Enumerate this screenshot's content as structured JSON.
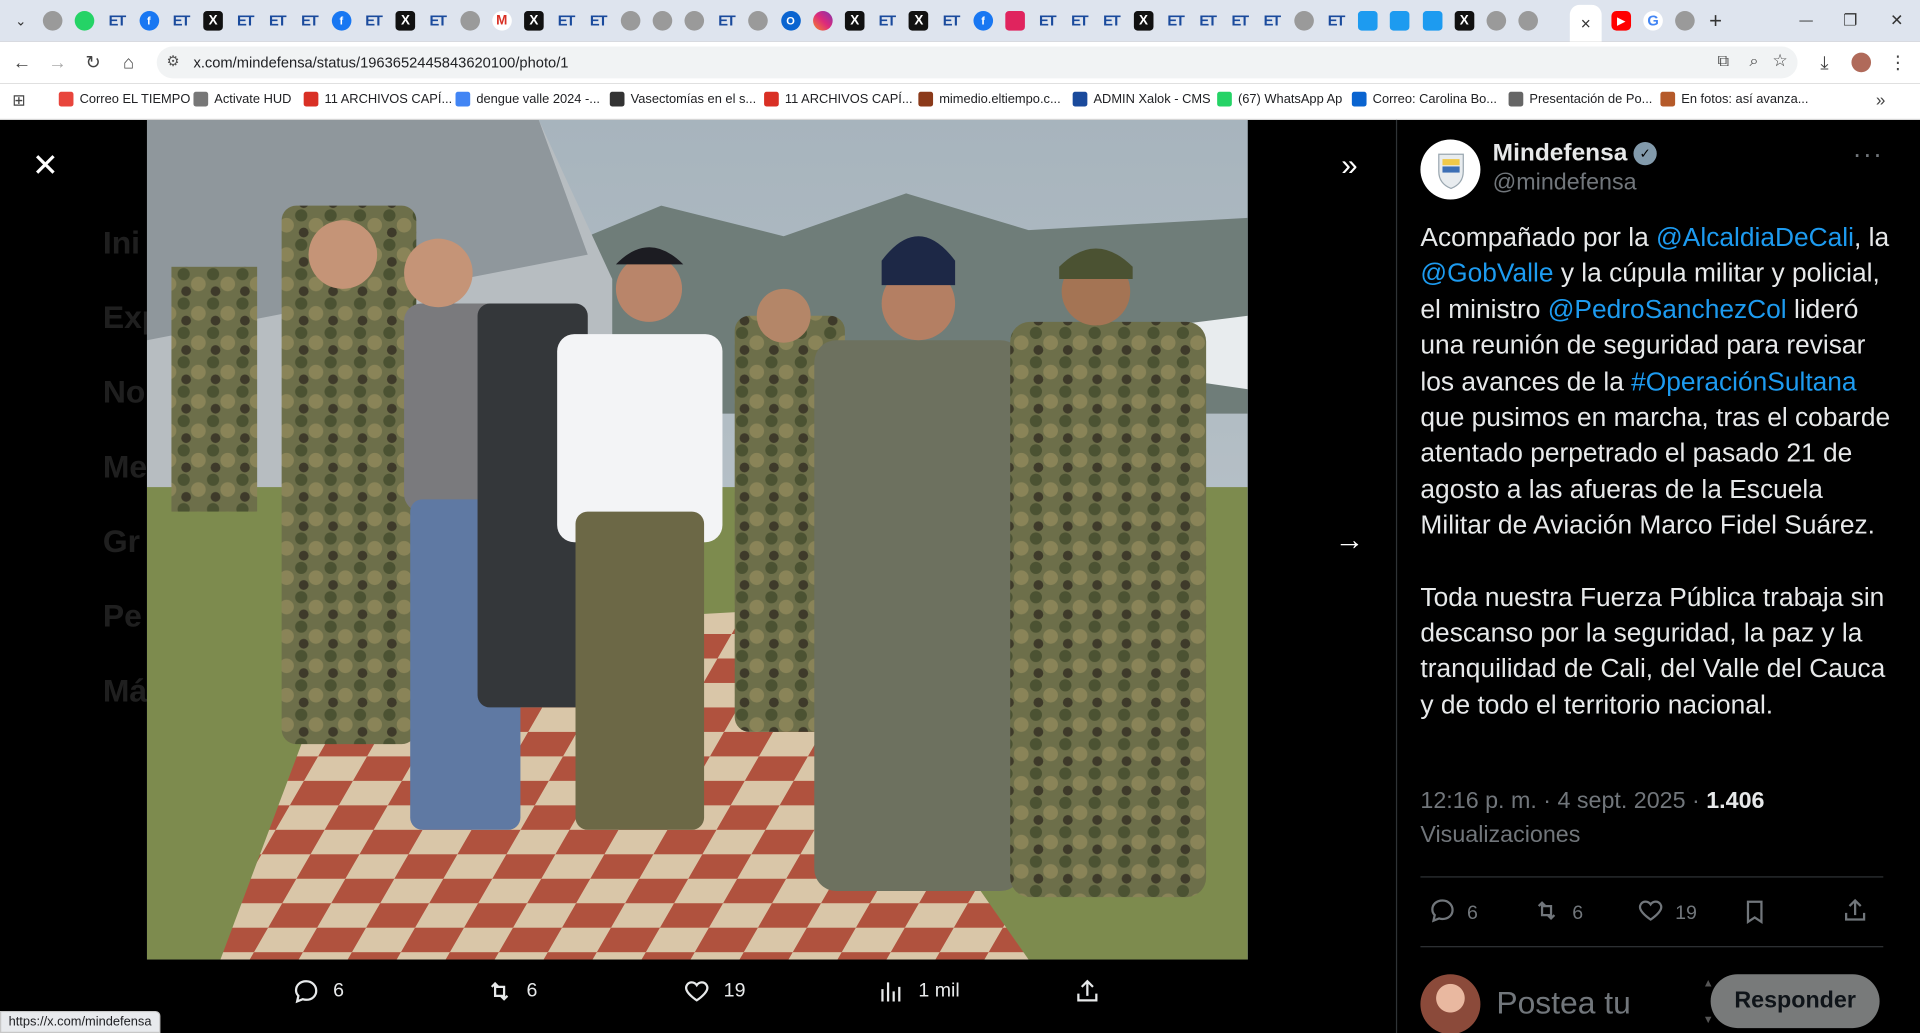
{
  "browser": {
    "tabs": [
      {
        "icon": "gray-globe-icon",
        "kind": "gr",
        "glyph": ""
      },
      {
        "icon": "whatsapp-icon",
        "kind": "wa",
        "glyph": ""
      },
      {
        "icon": "et-icon",
        "kind": "et",
        "glyph": "ET"
      },
      {
        "icon": "facebook-icon",
        "kind": "fb",
        "glyph": "f"
      },
      {
        "icon": "et-icon",
        "kind": "et",
        "glyph": "ET"
      },
      {
        "icon": "x-icon",
        "kind": "x",
        "glyph": "X"
      },
      {
        "icon": "et-icon",
        "kind": "et",
        "glyph": "ET"
      },
      {
        "icon": "et-icon",
        "kind": "et",
        "glyph": "ET"
      },
      {
        "icon": "et-icon",
        "kind": "et",
        "glyph": "ET"
      },
      {
        "icon": "facebook-icon",
        "kind": "fb",
        "glyph": "f"
      },
      {
        "icon": "et-icon",
        "kind": "et",
        "glyph": "ET"
      },
      {
        "icon": "x-icon",
        "kind": "x",
        "glyph": "X"
      },
      {
        "icon": "et-icon",
        "kind": "et",
        "glyph": "ET"
      },
      {
        "icon": "gray-globe-icon",
        "kind": "gr",
        "glyph": ""
      },
      {
        "icon": "gmail-icon",
        "kind": "gm",
        "glyph": "M"
      },
      {
        "icon": "x-icon",
        "kind": "x",
        "glyph": "X"
      },
      {
        "icon": "et-icon",
        "kind": "et",
        "glyph": "ET"
      },
      {
        "icon": "et-icon",
        "kind": "et",
        "glyph": "ET"
      },
      {
        "icon": "gray-globe-icon",
        "kind": "gr",
        "glyph": ""
      },
      {
        "icon": "gray-globe-icon",
        "kind": "gr",
        "glyph": ""
      },
      {
        "icon": "gray-globe-icon",
        "kind": "gr",
        "glyph": ""
      },
      {
        "icon": "et-icon",
        "kind": "et",
        "glyph": "ET"
      },
      {
        "icon": "gray-globe-icon",
        "kind": "gr",
        "glyph": ""
      },
      {
        "icon": "outlook-icon",
        "kind": "ol",
        "glyph": "O"
      },
      {
        "icon": "instagram-icon",
        "kind": "ig",
        "glyph": ""
      },
      {
        "icon": "x-icon",
        "kind": "x",
        "glyph": "X"
      },
      {
        "icon": "et-icon",
        "kind": "et",
        "glyph": "ET"
      },
      {
        "icon": "x-icon",
        "kind": "x",
        "glyph": "X"
      },
      {
        "icon": "et-icon",
        "kind": "et",
        "glyph": "ET"
      },
      {
        "icon": "facebook-icon",
        "kind": "fb",
        "glyph": "f"
      },
      {
        "icon": "red-app-icon",
        "kind": "rd",
        "glyph": ""
      },
      {
        "icon": "et-icon",
        "kind": "et",
        "glyph": "ET"
      },
      {
        "icon": "et-icon",
        "kind": "et",
        "glyph": "ET"
      },
      {
        "icon": "et-icon",
        "kind": "et",
        "glyph": "ET"
      },
      {
        "icon": "x-icon",
        "kind": "x",
        "glyph": "X"
      },
      {
        "icon": "et-icon",
        "kind": "et",
        "glyph": "ET"
      },
      {
        "icon": "et-icon",
        "kind": "et",
        "glyph": "ET"
      },
      {
        "icon": "et-icon",
        "kind": "et",
        "glyph": "ET"
      },
      {
        "icon": "et-icon",
        "kind": "et",
        "glyph": "ET"
      },
      {
        "icon": "gray-globe-icon",
        "kind": "gr",
        "glyph": ""
      },
      {
        "icon": "et-icon",
        "kind": "et",
        "glyph": "ET"
      },
      {
        "icon": "blue-edit-icon",
        "kind": "bl",
        "glyph": ""
      },
      {
        "icon": "blue-edit-icon",
        "kind": "bl",
        "glyph": ""
      },
      {
        "icon": "blue-app-icon",
        "kind": "bl",
        "glyph": ""
      },
      {
        "icon": "x-icon",
        "kind": "x",
        "glyph": "X"
      },
      {
        "icon": "gray-globe-icon",
        "kind": "gr",
        "glyph": ""
      },
      {
        "icon": "gray-globe-icon",
        "kind": "gr",
        "glyph": ""
      }
    ],
    "active_tab_close": "×",
    "trailing_tabs": [
      {
        "icon": "youtube-icon",
        "kind": "yt",
        "glyph": "▶"
      },
      {
        "icon": "google-icon",
        "kind": "gg",
        "glyph": "G"
      },
      {
        "icon": "gray-globe-icon",
        "kind": "gr",
        "glyph": ""
      }
    ],
    "new_tab": "+",
    "window_controls": {
      "minimize": "—",
      "restore": "❐",
      "close": "✕"
    },
    "url": "x.com/mindefensa/status/1963652445843620100/photo/1",
    "bookmarks": [
      {
        "label": "Correo EL TIEMPO",
        "color": "#e8453c"
      },
      {
        "label": "Activate HUD",
        "color": "#777777"
      },
      {
        "label": "11 ARCHIVOS CAPÍ...",
        "color": "#d93025"
      },
      {
        "label": "dengue valle 2024 -...",
        "color": "#4285f4"
      },
      {
        "label": "Vasectomías en el s...",
        "color": "#333333"
      },
      {
        "label": "11 ARCHIVOS CAPÍ...",
        "color": "#d93025"
      },
      {
        "label": "mimedio.eltiempo.c...",
        "color": "#8b3a1a"
      },
      {
        "label": "ADMIN Xalok - CMS",
        "color": "#1a4a9c"
      },
      {
        "label": "(67) WhatsApp Ap",
        "color": "#25d366"
      },
      {
        "label": "Correo: Carolina Bo...",
        "color": "#0a64d0"
      },
      {
        "label": "Presentación de Po...",
        "color": "#666666"
      },
      {
        "label": "En fotos: así avanza...",
        "color": "#b55a2a"
      }
    ],
    "status_url": "https://x.com/mindefensa"
  },
  "background_nav": [
    "Ini",
    "Exp",
    "No",
    "Me",
    "Gr",
    "Pe",
    "Má"
  ],
  "viewer": {
    "close_icon": "✕",
    "collapse_icon": "»",
    "next_icon": "→",
    "actions": {
      "replies": "6",
      "reposts": "6",
      "likes": "19",
      "views": "1 mil"
    }
  },
  "tweet": {
    "display_name": "Mindefensa",
    "handle": "@mindefensa",
    "more": "···",
    "text": [
      {
        "t": "Acompañado por la ",
        "link": false
      },
      {
        "t": "@AlcaldiaDeCali",
        "link": true
      },
      {
        "t": ", la ",
        "link": false
      },
      {
        "t": "@GobValle",
        "link": true
      },
      {
        "t": " y la cúpula militar y policial, el ministro ",
        "link": false
      },
      {
        "t": "@PedroSanchezCol",
        "link": true
      },
      {
        "t": " lideró una reunión de seguridad para revisar los avances de la ",
        "link": false
      },
      {
        "t": "#OperaciónSultana",
        "link": true
      },
      {
        "t": " que pusimos en marcha, tras el cobarde atentado perpetrado el pasado 21 de agosto a las afueras de la Escuela Militar de Aviación Marco Fidel Suárez.",
        "link": false
      }
    ],
    "text2": "Toda nuestra Fuerza Pública trabaja sin descanso por la seguridad, la paz y la tranquilidad de Cali, del Valle del Cauca y de todo el territorio nacional.",
    "time": "12:16 p. m. · 4 sept. 2025 · ",
    "views_count": "1.406",
    "views_label": "Visualizaciones",
    "stats": {
      "replies": "6",
      "reposts": "6",
      "likes": "19"
    },
    "reply_placeholder": "Postea tu",
    "reply_button": "Responder"
  }
}
